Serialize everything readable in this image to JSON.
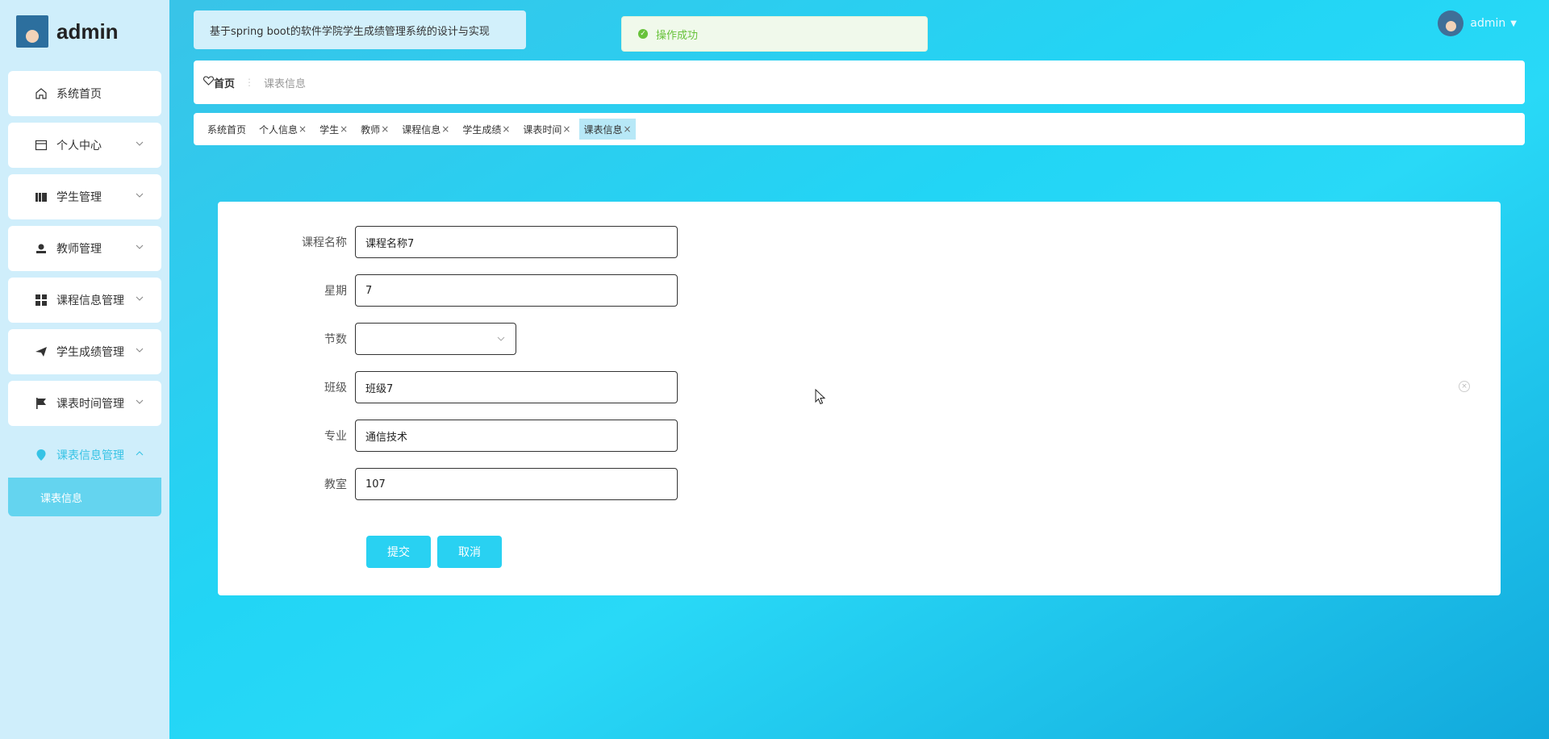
{
  "brand": {
    "name": "admin"
  },
  "sidebar": {
    "items": [
      {
        "label": "系统首页",
        "icon": "home-icon",
        "has_children": false
      },
      {
        "label": "个人中心",
        "icon": "calendar-icon",
        "has_children": true
      },
      {
        "label": "学生管理",
        "icon": "book-icon",
        "has_children": true
      },
      {
        "label": "教师管理",
        "icon": "user-icon",
        "has_children": true
      },
      {
        "label": "课程信息管理",
        "icon": "grid-icon",
        "has_children": true
      },
      {
        "label": "学生成绩管理",
        "icon": "send-icon",
        "has_children": true
      },
      {
        "label": "课表时间管理",
        "icon": "flag-icon",
        "has_children": true
      },
      {
        "label": "课表信息管理",
        "icon": "location-icon",
        "has_children": true,
        "expanded": true
      }
    ],
    "submenu": {
      "label": "课表信息"
    }
  },
  "header": {
    "system_title": "基于spring boot的软件学院学生成绩管理系统的设计与实现",
    "toast": "操作成功",
    "user_name": "admin"
  },
  "breadcrumb": {
    "home": "首页",
    "current": "课表信息"
  },
  "tags": [
    {
      "label": "系统首页",
      "closable": false
    },
    {
      "label": "个人信息",
      "closable": true
    },
    {
      "label": "学生",
      "closable": true
    },
    {
      "label": "教师",
      "closable": true
    },
    {
      "label": "课程信息",
      "closable": true
    },
    {
      "label": "学生成绩",
      "closable": true
    },
    {
      "label": "课表时间",
      "closable": true
    },
    {
      "label": "课表信息",
      "closable": true,
      "active": true
    }
  ],
  "form": {
    "course_name": {
      "label": "课程名称",
      "value": "课程名称7"
    },
    "weekday": {
      "label": "星期",
      "value": "7"
    },
    "period": {
      "label": "节数",
      "value": ""
    },
    "class": {
      "label": "班级",
      "value": "班级7"
    },
    "major": {
      "label": "专业",
      "value": "通信技术"
    },
    "classroom": {
      "label": "教室",
      "value": "107"
    },
    "submit_label": "提交",
    "cancel_label": "取消"
  },
  "colors": {
    "accent": "#29d1f2",
    "sidebar_bg": "#cfeefb",
    "success": "#67c23a"
  }
}
